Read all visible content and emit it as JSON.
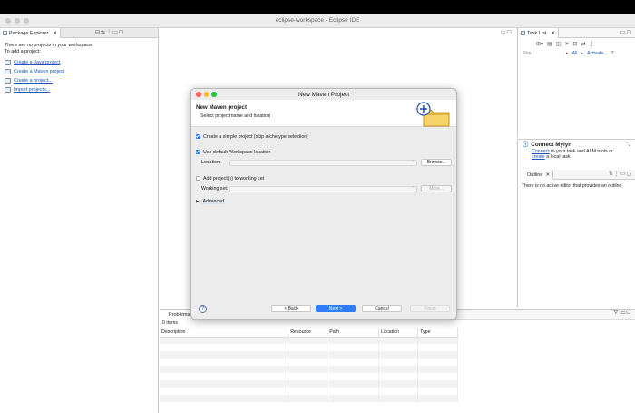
{
  "window": {
    "title": "eclipse-workspace - Eclipse IDE"
  },
  "package_explorer": {
    "tab_label": "Package Explorer",
    "intro_line1": "There are no projects in your workspace.",
    "intro_line2": "To add a project:",
    "links": [
      "Create a Java project",
      "Create a Maven project",
      "Create a project...",
      "Import projects..."
    ]
  },
  "task_list": {
    "tab_label": "Task List",
    "filter_placeholder": "Find",
    "all_label": "All",
    "activate_label": "Activate..."
  },
  "connect_mylyn": {
    "title": "Connect Mylyn",
    "connect_link": "Connect",
    "line1_rest": " to your task and ALM tools or",
    "create_link": "create",
    "line2_rest": " a local task."
  },
  "outline": {
    "tab_label": "Outline",
    "message": "There is no active editor that provides an outline."
  },
  "problems": {
    "tab_label": "Problems",
    "count": "0 items",
    "columns": [
      "Description",
      "Resource",
      "Path",
      "Location",
      "Type"
    ]
  },
  "dialog": {
    "title": "New Maven Project",
    "header": "New Maven project",
    "subheader": "Select project name and location",
    "simple_project_label": "Create a simple project (skip archetype selection)",
    "default_workspace_label": "Use default Workspace location",
    "location_label": "Location:",
    "browse_label": "Browse...",
    "add_working_set_label": "Add project(s) to working set",
    "working_set_label": "Working set:",
    "more_label": "More...",
    "advanced_label": "Advanced",
    "help_glyph": "?",
    "back_label": "< Back",
    "next_label": "Next >",
    "cancel_label": "Cancel",
    "finish_label": "Finish"
  }
}
